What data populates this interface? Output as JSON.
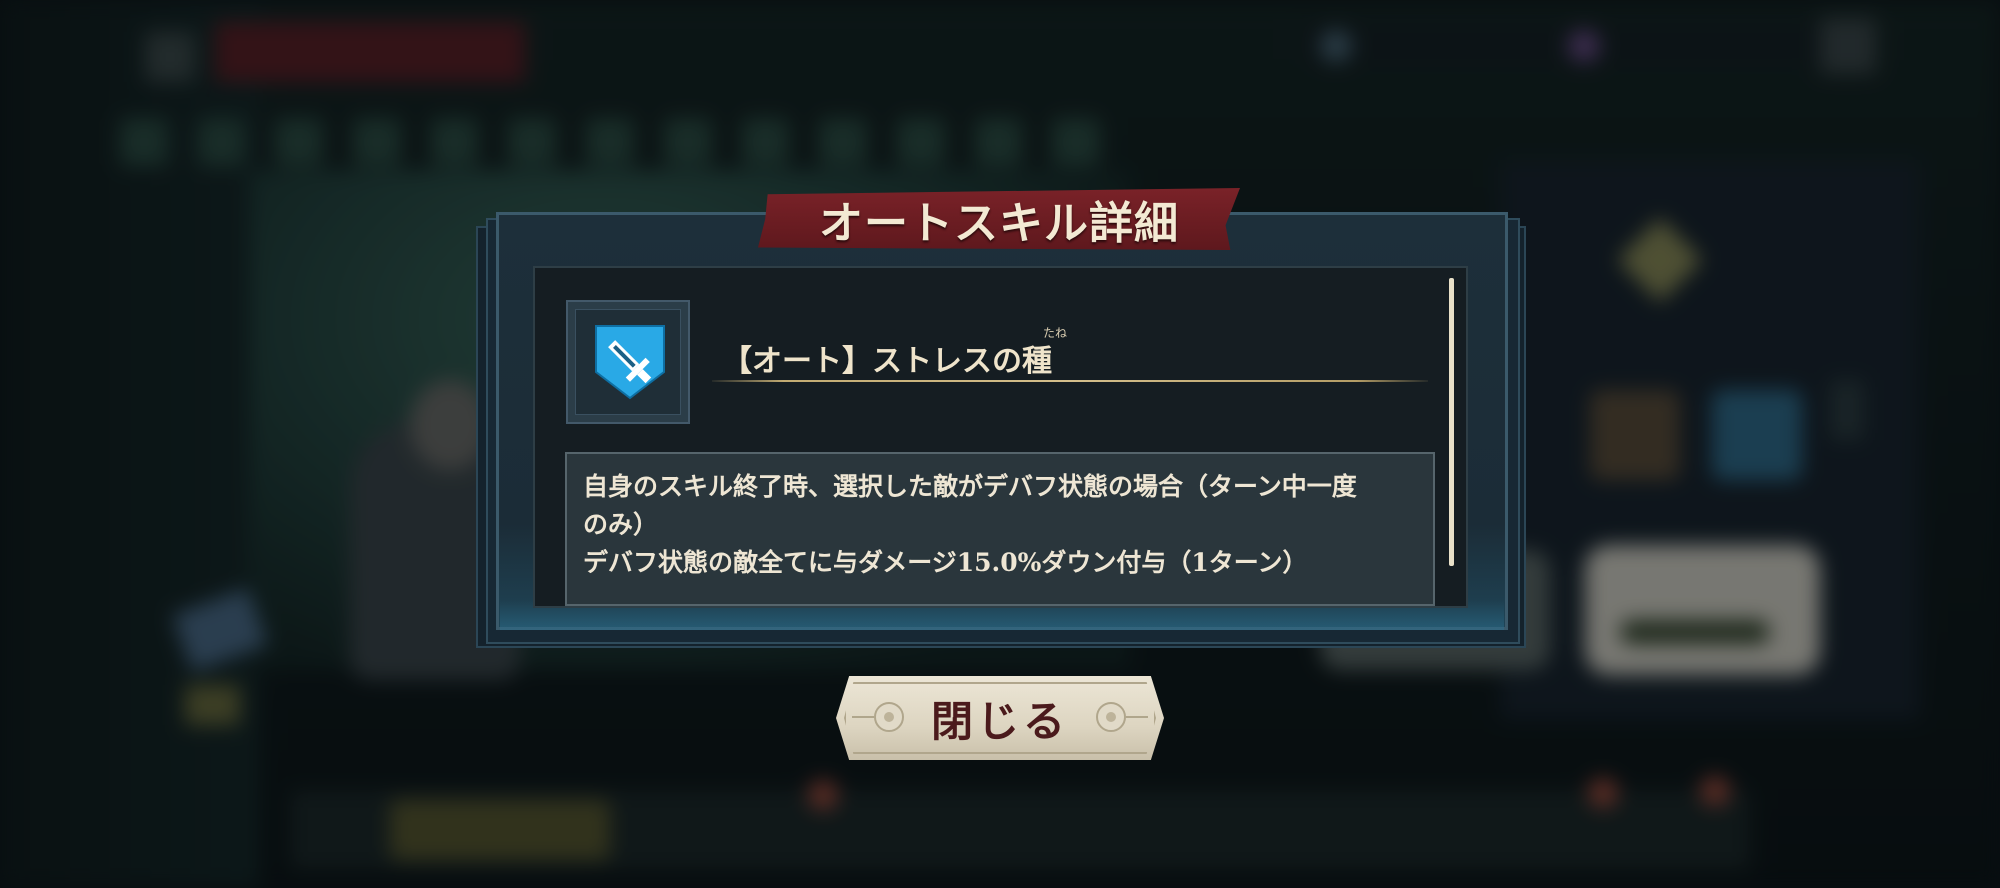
{
  "dialog": {
    "title": "オートスキル詳細",
    "skill": {
      "icon": "sword-shield-icon",
      "name": "【オート】ストレスの種",
      "ruby": "たね",
      "description_lines": [
        "自身のスキル終了時、選択した敵がデバフ状態の場合（ターン中一度",
        "のみ）",
        "デバフ状態の敵全てに与ダメージ15.0%ダウン付与（1ターン）"
      ]
    },
    "close_label": "閉じる"
  },
  "colors": {
    "title_banner": "#6e1e24",
    "panel_bg": "#151d22",
    "skill_icon_blue": "#29a9e6",
    "text_cream": "#efe4cb",
    "button_cream": "#e3dccb",
    "button_text": "#4b1a1c"
  }
}
